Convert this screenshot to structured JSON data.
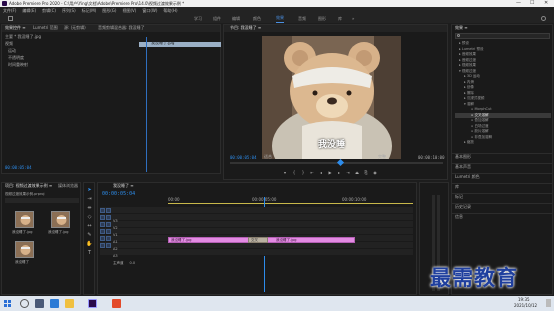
{
  "titlebar": {
    "title": "Adobe Premiere Pro 2020 - C:\\用户\\Ying\\文档\\Adobe\\Premiere Pro\\14.0\\视频过渡效果示例 *",
    "minimize": "—",
    "maximize": "☐",
    "close": "✕"
  },
  "menu": [
    "文件(F)",
    "编辑(E)",
    "剪辑(C)",
    "序列(S)",
    "标记(M)",
    "图形(G)",
    "视图(V)",
    "窗口(W)",
    "帮助(H)"
  ],
  "workspaces": [
    "学习",
    "组件",
    "编辑",
    "颜色",
    "效果",
    "音频",
    "图形",
    "库",
    "»"
  ],
  "active_workspace": "效果",
  "source_panel": {
    "tabs": [
      "效果控件 ≡",
      "Lumetri 范围",
      "源: (无剪辑)",
      "音频剪辑混合器: 我没睡了"
    ],
    "row1": "主要 * 我没睡了.jpg",
    "row2": "视频",
    "fx1": "运动",
    "fx2": "不透明度",
    "fx3": "时间重映射",
    "clip_label": "我没睡了.jpg",
    "timecode": "00:00:05:04"
  },
  "program": {
    "tab": "节目: 我没睡了 ≡",
    "caption": "我没睡",
    "timecode_left": "00:00:05:04",
    "fit": "适合",
    "ratio": "完整",
    "timecode_right": "00:00:10:00"
  },
  "effects_panel": {
    "title": "效果 ≡",
    "search_placeholder": "",
    "tree": [
      "预设",
      "Lumetri 预设",
      "音频效果",
      "音频过渡",
      "视频效果",
      "视频过渡",
      "3D 运动",
      "内滑",
      "划像",
      "擦除",
      "沉浸式视频",
      "溶解",
      "MorphCut",
      "交叉溶解",
      "叠加溶解",
      "白场过渡",
      "胶片溶解",
      "非叠加溶解",
      "缩放"
    ],
    "selected": "交叉溶解",
    "sections": [
      "基本图形",
      "基本声音",
      "Lumetri 颜色",
      "库",
      "标记",
      "历史记录",
      "信息"
    ]
  },
  "project_panel": {
    "tabs": [
      "项目: 视频过渡效果示例 ≡",
      "媒体浏览器"
    ],
    "file": "视频过渡效果示例.prproj",
    "items": [
      "我没睡了.jpg",
      "我没睡了.jpg",
      "我没睡了"
    ]
  },
  "timeline": {
    "tab": "我没睡了 ≡",
    "timecode": "00:00:05:04",
    "ruler": [
      "00:00",
      "00:00:05:00",
      "00:00:10:00"
    ],
    "tracks": [
      "V3",
      "V2",
      "V1",
      "A1",
      "A2",
      "A3",
      "主声道"
    ],
    "master_value": "0.0",
    "clip1": "我没睡了.jpg",
    "clip2": "我没睡了.jpg",
    "transition": "交叉"
  },
  "taskbar": {
    "time": "19:35",
    "date": "2021/10/12"
  },
  "watermark": "最需教育",
  "colors": {
    "accent": "#2d8ceb",
    "clip": "#e38be3",
    "selection": "#9bb0c6"
  }
}
